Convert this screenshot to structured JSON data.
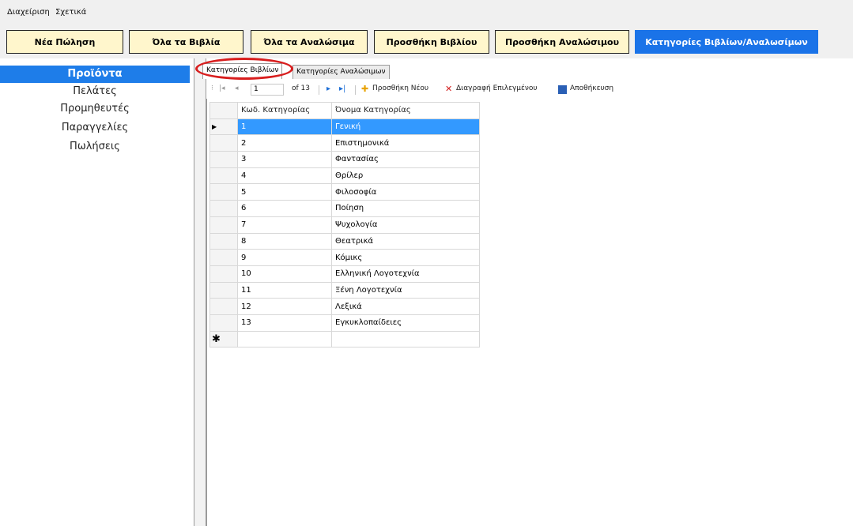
{
  "menu": {
    "items": [
      "Διαχείριση",
      "Σχετικά"
    ]
  },
  "toolbar": {
    "buttons": [
      "Νέα Πώληση",
      "Όλα τα Βιβλία",
      "Όλα τα Αναλώσιμα",
      "Προσθήκη Βιβλίου",
      "Προσθήκη Αναλώσιμου",
      "Κατηγορίες Βιβλίων/Αναλωσίμων"
    ],
    "active_index": 5
  },
  "sidebar": {
    "items": [
      "Προϊόντα",
      "Πελάτες",
      "Προμηθευτές",
      "Παραγγελίες",
      "Πωλήσεις"
    ],
    "selected_index": 0
  },
  "tabs": {
    "items": [
      "Κατηγορίες Βιβλίων",
      "Κατηγορίες Αναλώσιμων"
    ],
    "active_index": 0
  },
  "navigator": {
    "position": "1",
    "of_total": "of 13",
    "add_label": "Προσθήκη Νέου",
    "delete_label": "Διαγραφή Επιλεγμένου",
    "save_label": "Αποθήκευση"
  },
  "grid": {
    "columns": [
      "Κωδ. Κατηγορίας",
      "Όνομα Κατηγορίας"
    ],
    "rows": [
      [
        "1",
        "Γενική"
      ],
      [
        "2",
        "Επιστημονικά"
      ],
      [
        "3",
        "Φαντασίας"
      ],
      [
        "4",
        "Θρίλερ"
      ],
      [
        "5",
        "Φιλοσοφία"
      ],
      [
        "6",
        "Ποίηση"
      ],
      [
        "7",
        "Ψυχολογία"
      ],
      [
        "8",
        "Θεατρικά"
      ],
      [
        "9",
        "Κόμικς"
      ],
      [
        "10",
        "Ελληνική Λογοτεχνία"
      ],
      [
        "11",
        "Ξένη Λογοτεχνία"
      ],
      [
        "12",
        "Λεξικά"
      ],
      [
        "13",
        "Εγκυκλοπαίδειες"
      ]
    ],
    "selected_row": 0,
    "new_row_marker": "✱"
  },
  "colors": {
    "accent": "#1a73e8",
    "button_bg": "#fff6cc",
    "highlight": "#d81e1e",
    "row_selection": "#3399ff"
  }
}
